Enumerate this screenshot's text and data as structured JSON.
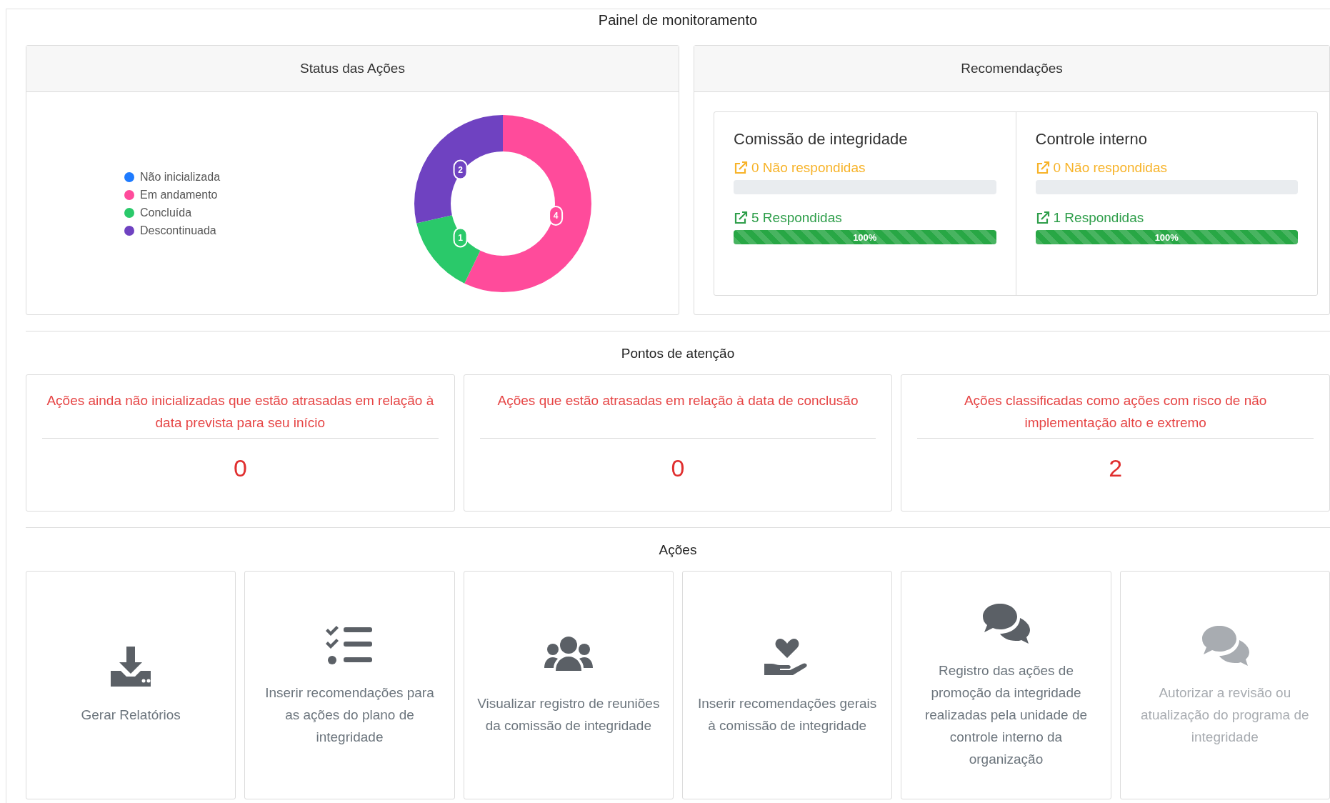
{
  "title": "Painel de monitoramento",
  "status_panel": {
    "title": "Status das Ações",
    "chart_data": {
      "type": "donut",
      "categories": [
        "Não inicializada",
        "Em andamento",
        "Concluída",
        "Descontinuada"
      ],
      "values": [
        0,
        4,
        1,
        2
      ],
      "colors": [
        "#1e7bff",
        "#ff4b9b",
        "#2ac96a",
        "#6f42c1"
      ],
      "data_labels": true,
      "legend": "left"
    }
  },
  "recommendations": {
    "title": "Recomendações",
    "groups": [
      {
        "title": "Comissão de integridade",
        "rows": [
          {
            "kind": "pending",
            "label": "0 Não respondidas",
            "level": 0
          },
          {
            "kind": "answered",
            "label": "5 Respondidas",
            "level": 1,
            "reading": "100%"
          }
        ]
      },
      {
        "title": "Controle interno",
        "rows": [
          {
            "kind": "pending",
            "label": "0 Não respondidas",
            "level": 0
          },
          {
            "kind": "answered",
            "label": "1 Respondidas",
            "level": 1,
            "reading": "100%"
          }
        ]
      }
    ]
  },
  "attention": {
    "title": "Pontos de atenção",
    "cards": [
      {
        "text": "Ações ainda não inicializadas que estão atrasadas em relação à data prevista para seu início",
        "count": "0"
      },
      {
        "text": "Ações que estão atrasadas em relação à data de conclusão",
        "count": "0"
      },
      {
        "text": "Ações classificadas como ações com risco de não implementação alto e extremo",
        "count": "2"
      }
    ]
  },
  "actions": {
    "title": "Ações",
    "items": [
      {
        "kind": "download",
        "label": "Gerar Relatórios",
        "disabled": false
      },
      {
        "kind": "checklist",
        "label": "Inserir recomendações para as ações do plano de integridade",
        "disabled": false
      },
      {
        "kind": "people",
        "label": "Visualizar registro de reuniões da comissão de integridade",
        "disabled": false
      },
      {
        "kind": "care",
        "label": "Inserir recomendações gerais à comissão de integridade",
        "disabled": false
      },
      {
        "kind": "chat",
        "label": "Registro das ações de promoção da integridade realizadas pela unidade de controle interno da organização",
        "disabled": false
      },
      {
        "kind": "chat",
        "label": "Autorizar a revisão ou atualização do programa de integridade",
        "disabled": true
      }
    ]
  }
}
